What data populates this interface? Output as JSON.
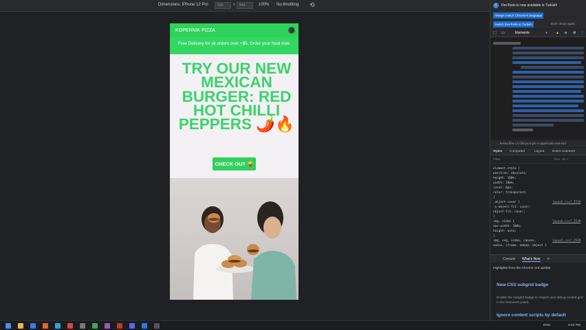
{
  "toolbar": {
    "dimensions_label": "Dimensions: iPhone 12 Pro",
    "width_value": "390",
    "height_value": "844",
    "x_label": "x",
    "zoom": "100%",
    "throttling": "No throttling",
    "rotate_icon": "rotate-icon"
  },
  "site": {
    "brand": "KOPERNIK PIZZA",
    "promo": "Free Delivery for all orders over +$5. Order your food now.",
    "headline": "TRY OUR NEW MEXICAN BURGER: RED HOT CHILLI PEPPERS 🌶️🔥",
    "cta": "CHECK OUT 🍟",
    "accent": "#2fd35c"
  },
  "devtools": {
    "notice": "DevTools is now available in Turkish!",
    "btn_match": "Always match Chrome's language",
    "btn_switch": "Switch DevTools to Turkish",
    "dont_show": "Don't show again",
    "panel_tabs": [
      "Elements"
    ],
    "breadcrumb": "… below.flex-1.h-full.px-6.pb-4.uppercase.text-red",
    "styles_tabs": [
      "Styles",
      "Computed",
      "Layout",
      "Event Listeners"
    ],
    "filter_placeholder": "Filter",
    "filter_tools": ":hov  .cls  +",
    "rules": [
      {
        "t": "element.style {"
      },
      {
        "t": "  position: absolute;"
      },
      {
        "t": "  height: 100%;"
      },
      {
        "t": "  width: 100%;"
      },
      {
        "t": "  inset: 0px;"
      },
      {
        "t": "  color: transparent;"
      },
      {
        "t": "}"
      },
      {
        "t": ".object-cover {",
        "src": "layout.css?_2529"
      },
      {
        "t": "  -o-object-fit: cover;"
      },
      {
        "t": "  object-fit: cover;"
      },
      {
        "t": "}"
      },
      {
        "t": "img, video {",
        "src": "layout.css?_2529"
      },
      {
        "t": "  max-width: 100%;"
      },
      {
        "t": "  height: auto;"
      },
      {
        "t": "}"
      },
      {
        "t": "img, svg, video, canvas,",
        "src": "layout.css?_2529"
      },
      {
        "t": "audio, iframe, embed, object {"
      }
    ],
    "bottom_tabs": [
      "Console",
      "What's New"
    ],
    "whatsnew_sub": "Highlights from the Chrome 115 update",
    "h1": "New CSS subgrid badge",
    "p1": "Enable the subgrid badge to inspect and debug nested grid in the Elements panel.",
    "h2": "Ignore content scripts by default"
  },
  "taskbar": {
    "lang": "ENG",
    "time": "9:23 PM"
  }
}
